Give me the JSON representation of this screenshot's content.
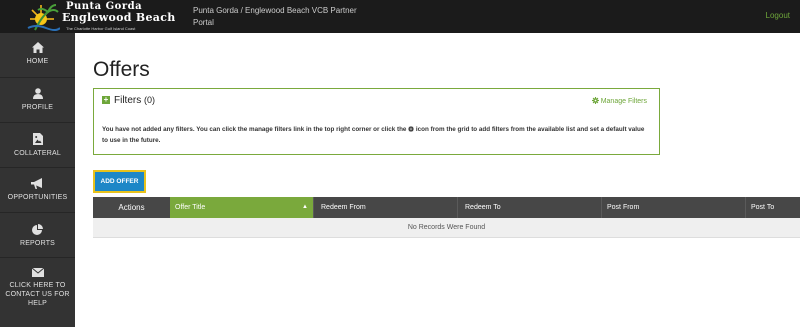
{
  "header": {
    "logo": {
      "line1": "Punta Gorda",
      "line2": "Englewood Beach",
      "tagline": "The Charlotte Harbor Gulf Island Coast"
    },
    "portal_title": "Punta Gorda / Englewood Beach VCB Partner Portal",
    "logout_label": "Logout"
  },
  "sidebar": {
    "items": [
      {
        "label": "HOME",
        "icon": "home-icon"
      },
      {
        "label": "PROFILE",
        "icon": "user-icon"
      },
      {
        "label": "COLLATERAL",
        "icon": "image-file-icon"
      },
      {
        "label": "OPPORTUNITIES",
        "icon": "bullhorn-icon"
      },
      {
        "label": "REPORTS",
        "icon": "pie-chart-icon"
      },
      {
        "label": "CLICK HERE TO CONTACT US FOR HELP",
        "icon": "envelope-icon"
      }
    ]
  },
  "main": {
    "title": "Offers",
    "filters": {
      "label": "Filters",
      "count": "(0)",
      "manage_label": "Manage Filters",
      "description_part1": "You have not added any filters. You can click the manage filters link in the top right corner or click the",
      "description_part2": "icon from the grid to add filters from the available list and set a default value to use in the future."
    },
    "add_button_label": "ADD OFFER",
    "grid": {
      "columns": [
        "Actions",
        "Offer Title",
        "Redeem From",
        "Redeem To",
        "Post From",
        "Post To"
      ],
      "empty_message": "No Records Were Found"
    }
  },
  "colors": {
    "accent_green": "#7aa93c",
    "button_blue": "#1d87c7",
    "button_outline": "#e8c21c",
    "sidebar_bg": "#333333",
    "topbar_bg": "#1b1b1b"
  }
}
